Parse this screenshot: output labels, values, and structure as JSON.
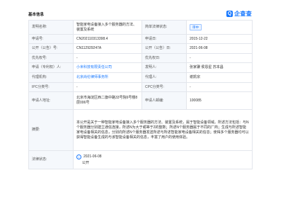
{
  "header": {
    "title": "基本信息",
    "brand": "企查查",
    "brand_icon": "Q"
  },
  "rows": {
    "invention_name_k": "发明名称:",
    "invention_name_v": "智能家电设备接入多个服务器的方法、装置及系统",
    "legal_status_k": "简单法律状态:",
    "legal_status_v": "审中",
    "app_no_k": "申请号:",
    "app_no_v": "CN202110313398.4",
    "app_date_k": "申请日:",
    "app_date_v": "2015-12-22",
    "pub_no_k": "公开（公告）号:",
    "pub_no_v": "CN112929247A",
    "pub_date_k": "公开（公告）日:",
    "pub_date_v": "2021-06-08",
    "priority_no_k": "优先权号:",
    "priority_no_v": "-",
    "priority_date_k": "优先权日:",
    "priority_date_v": "-",
    "applicant_k": "申请（专利权）人:",
    "applicant_v": "小米科技有限责任公司",
    "inventor_k": "发明人:",
    "inventor_v": "张家骥 侯恩星 苏本昌",
    "agency_k": "代理机构:",
    "agency_v": "北京尚伦律师事务所",
    "agent_k": "代理人:",
    "agent_v": "谢凯宗",
    "ipc_k": "IPC分类号:",
    "ipc_v": "-",
    "cpc_k": "CPC分类号:",
    "cpc_v": "-",
    "address_k": "申请人地址:",
    "address_v": "北京市海淀区西二旗中路33号院6号楼8层006号",
    "postcode_k": "申请人邮编:",
    "postcode_v": "100085",
    "abstract_k": "摘要:",
    "abstract_v": "本公开是关于一种智能家电设备接入多个服务器的方法、装置及系统，属于智能设备领域。所述方法包括：与N个服务器分别建立通信连接，所述N为大于或等于2的整数；所述N个服务器属于不同的厂商；生成与所述智能家电设备相关的信息，分别向所述N个服务器发送所述与所述智能家电设备相关的信息；使得多个服务器均可以获得智能设备生成的与该智能设备相关的信息，丰富了用户的使用体验。",
    "law_status_k": "法律状态:",
    "law_status_date": "2021-06-08",
    "law_status_text": "公开"
  }
}
